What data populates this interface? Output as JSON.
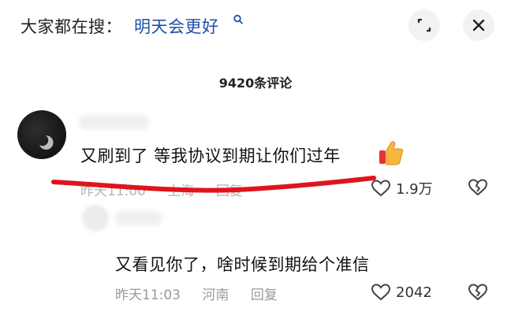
{
  "search": {
    "prefix": "大家都在搜：",
    "term": "明天会更好",
    "icon": "search-icon"
  },
  "actions": {
    "expand_icon": "expand-icon",
    "close_icon": "close-icon"
  },
  "comment_count": "9420条评论",
  "comments": [
    {
      "text": "又刷到了 等我协议到期让你们过年",
      "emoji": "thumbs-up-icon",
      "date": "昨天11:00",
      "location": "上海",
      "reply": "回复",
      "likes": "1.9万"
    },
    {
      "text": "又看见你了，啥时候到期给个准信",
      "date": "昨天11:03",
      "location": "河南",
      "reply": "回复",
      "likes": "2042"
    }
  ],
  "colors": {
    "search_term": "#1f4fa8",
    "annotation_line": "#e0141b",
    "meta_text": "#9a9a9a"
  }
}
